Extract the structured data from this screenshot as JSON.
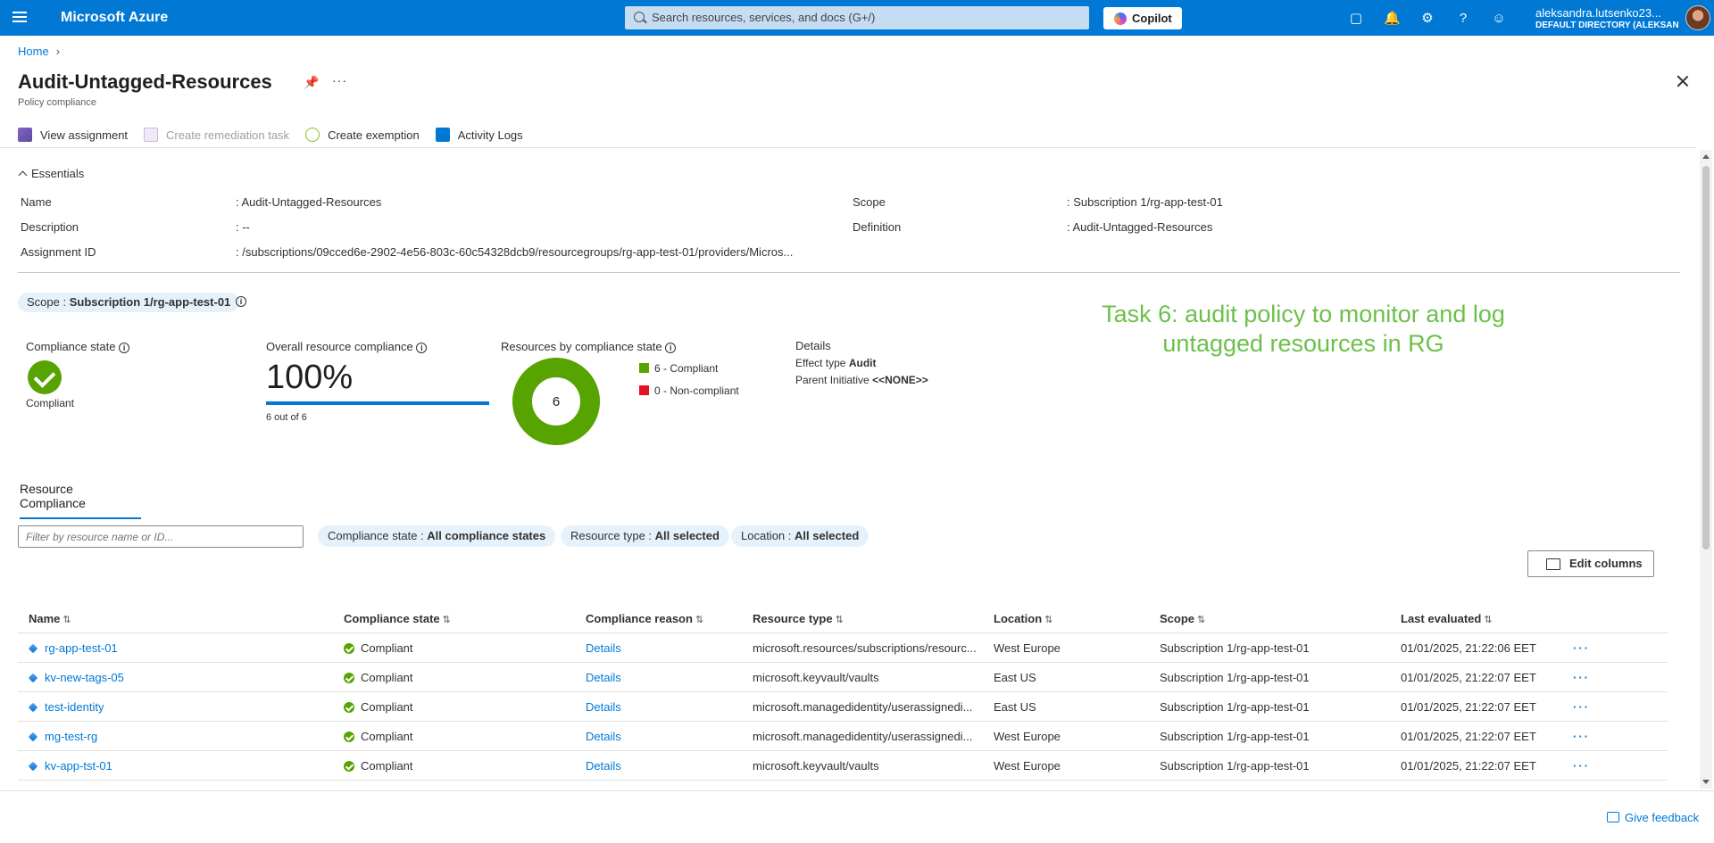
{
  "topbar": {
    "brand": "Microsoft Azure",
    "search_placeholder": "Search resources, services, and docs (G+/)",
    "copilot_label": "Copilot",
    "user_name": "aleksandra.lutsenko23...",
    "user_directory": "DEFAULT DIRECTORY (ALEKSAND...",
    "icons": [
      "cloud-shell-icon",
      "bell-icon",
      "gear-icon",
      "help-icon",
      "feedback-icon"
    ]
  },
  "breadcrumb": {
    "home": "Home"
  },
  "page": {
    "title": "Audit-Untagged-Resources",
    "subtitle": "Policy compliance"
  },
  "toolbar": {
    "view_assignment": "View assignment",
    "create_remediation": "Create remediation task",
    "create_exemption": "Create exemption",
    "activity_logs": "Activity Logs"
  },
  "essentials": {
    "toggle": "Essentials",
    "name_label": "Name",
    "name_value": ": Audit-Untagged-Resources",
    "description_label": "Description",
    "description_value": ": --",
    "assignment_id_label": "Assignment ID",
    "assignment_id_value": ": /subscriptions/09cced6e-2902-4e56-803c-60c54328dcb9/resourcegroups/rg-app-test-01/providers/Micros...",
    "scope_label": "Scope",
    "scope_value": ": Subscription 1/rg-app-test-01",
    "definition_label": "Definition",
    "definition_value": ": Audit-Untagged-Resources"
  },
  "scope_pill": {
    "prefix": "Scope : ",
    "value": "Subscription 1/rg-app-test-01"
  },
  "compliance": {
    "state_label": "Compliance state",
    "state_value": "Compliant",
    "overall_label": "Overall resource compliance",
    "overall_pct": "100%",
    "overall_fraction": 1.0,
    "overall_count": "6 out of 6",
    "by_state_label": "Resources by compliance state",
    "donut_center": "6",
    "legend": [
      {
        "label": "6 - Compliant",
        "count": 6,
        "color": "#57a300"
      },
      {
        "label": "0 - Non-compliant",
        "count": 0,
        "color": "#e81123"
      }
    ],
    "details_title": "Details",
    "effect_label": "Effect type",
    "effect_value": "Audit",
    "initiative_label": "Parent Initiative",
    "initiative_value": "<<NONE>>"
  },
  "annotation": "Task 6: audit policy to monitor and log untagged resources in RG",
  "tab": "Resource Compliance",
  "filters": {
    "input_placeholder": "Filter by resource name or ID...",
    "compliance_prefix": "Compliance state : ",
    "compliance_value": "All compliance states",
    "type_prefix": "Resource type : ",
    "type_value": "All selected",
    "location_prefix": "Location : ",
    "location_value": "All selected",
    "edit_columns": "Edit columns"
  },
  "table": {
    "columns": [
      "Name",
      "Compliance state",
      "Compliance reason",
      "Resource type",
      "Location",
      "Scope",
      "Last evaluated"
    ],
    "rows": [
      {
        "name": "rg-app-test-01",
        "state": "Compliant",
        "reason": "Details",
        "type": "microsoft.resources/subscriptions/resourc...",
        "location": "West Europe",
        "scope": "Subscription 1/rg-app-test-01",
        "evaluated": "01/01/2025, 21:22:06 EET",
        "more": "···"
      },
      {
        "name": "kv-new-tags-05",
        "state": "Compliant",
        "reason": "Details",
        "type": "microsoft.keyvault/vaults",
        "location": "East US",
        "scope": "Subscription 1/rg-app-test-01",
        "evaluated": "01/01/2025, 21:22:07 EET",
        "more": "···"
      },
      {
        "name": "test-identity",
        "state": "Compliant",
        "reason": "Details",
        "type": "microsoft.managedidentity/userassignedi...",
        "location": "East US",
        "scope": "Subscription 1/rg-app-test-01",
        "evaluated": "01/01/2025, 21:22:07 EET",
        "more": "···"
      },
      {
        "name": "mg-test-rg",
        "state": "Compliant",
        "reason": "Details",
        "type": "microsoft.managedidentity/userassignedi...",
        "location": "West Europe",
        "scope": "Subscription 1/rg-app-test-01",
        "evaluated": "01/01/2025, 21:22:07 EET",
        "more": "···"
      },
      {
        "name": "kv-app-tst-01",
        "state": "Compliant",
        "reason": "Details",
        "type": "microsoft.keyvault/vaults",
        "location": "West Europe",
        "scope": "Subscription 1/rg-app-test-01",
        "evaluated": "01/01/2025, 21:22:07 EET",
        "more": "···"
      }
    ]
  },
  "footer": {
    "feedback": "Give feedback"
  },
  "colors": {
    "azure_blue": "#0078d4",
    "compliant_green": "#57a300",
    "noncompliant_red": "#e81123",
    "annotation_green": "#6cc04a"
  }
}
